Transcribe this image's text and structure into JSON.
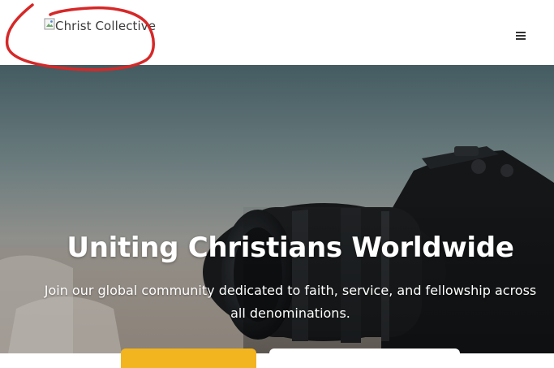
{
  "header": {
    "logo_alt": "Christ Collective",
    "menu_icon": "hamburger-icon"
  },
  "hero": {
    "title": "Uniting Christians Worldwide",
    "subtitle": "Join our global community dedicated to faith, service, and fellowship across all denominations."
  },
  "colors": {
    "annotation": "#d62828",
    "cta_primary": "#f2b41f",
    "text_on_hero": "#ffffff"
  }
}
